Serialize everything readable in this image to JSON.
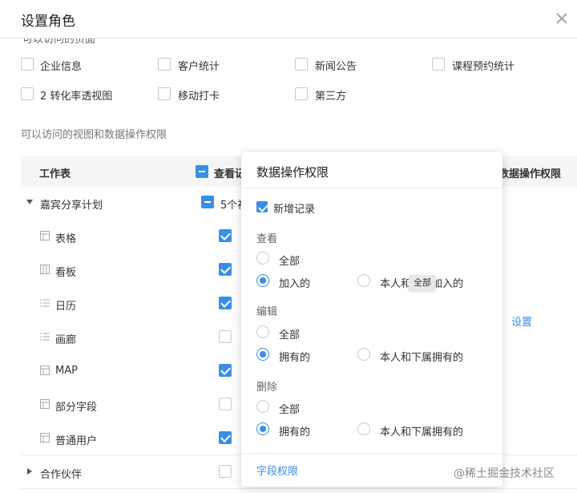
{
  "dialog": {
    "title": "设置角色",
    "clipped_heading": "可以访问的页面",
    "pages": [
      {
        "label": "企业信息",
        "checked": false
      },
      {
        "label": "客户统计",
        "checked": false
      },
      {
        "label": "新闻公告",
        "checked": false
      },
      {
        "label": "课程预约统计",
        "checked": false
      },
      {
        "label": "2 转化率透视图",
        "checked": false
      },
      {
        "label": "移动打卡",
        "checked": false
      },
      {
        "label": "第三方",
        "checked": false
      }
    ],
    "section_label": "可以访问的视图和数据操作权限",
    "table": {
      "col_sheet": "工作表",
      "col_view": "查看记",
      "col_perm": "数据操作权限",
      "group1": {
        "label": "嘉宾分享计划",
        "view_count": "5个视"
      },
      "rows": [
        {
          "label": "表格",
          "icon": "grid-icon",
          "checked": true
        },
        {
          "label": "看板",
          "icon": "kanban-icon",
          "checked": true
        },
        {
          "label": "日历",
          "icon": "list-icon",
          "checked": true
        },
        {
          "label": "画廊",
          "icon": "list-icon",
          "checked": false
        },
        {
          "label": "MAP",
          "icon": "grid-icon",
          "checked": true
        },
        {
          "label": "部分字段",
          "icon": "grid-icon",
          "checked": false
        },
        {
          "label": "普通用户",
          "icon": "grid-icon",
          "checked": true
        }
      ],
      "group2": {
        "label": "合作伙伴"
      },
      "settings_link": "设置"
    }
  },
  "popup": {
    "title": "数据操作权限",
    "add_record": "新增记录",
    "view_label": "查看",
    "edit_label": "编辑",
    "delete_label": "删除",
    "opt_all": "全部",
    "opt_joined": "加入的",
    "opt_self_sub_joined": "本人和下属加入的",
    "opt_owned": "拥有的",
    "opt_self_sub_owned": "本人和下属拥有的",
    "field_perm_link": "字段权限",
    "tooltip": "全部"
  },
  "watermark": "@稀土掘金技术社区",
  "colors": {
    "accent": "#3a8ee6"
  }
}
